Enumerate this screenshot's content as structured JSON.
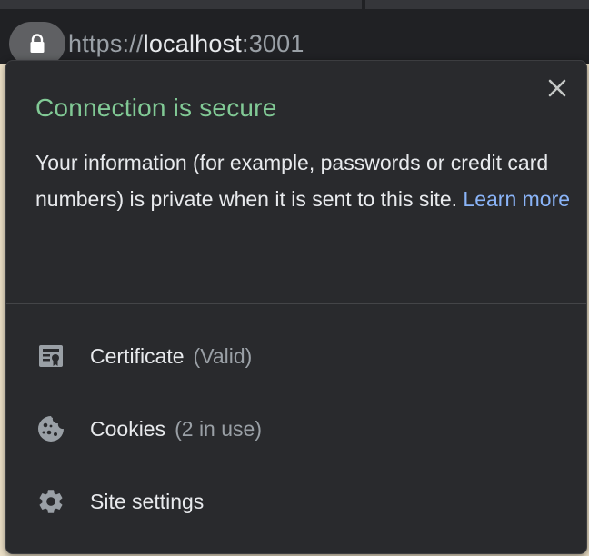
{
  "toolbar": {
    "url_scheme": "https://",
    "url_host": "localhost",
    "url_port": ":3001",
    "lock_icon": "lock-icon"
  },
  "popup": {
    "title": "Connection is secure",
    "description": "Your information (for example, passwords or credit card numbers) is private when it is sent to this site.",
    "learn_more": "Learn more",
    "close_icon": "close-icon",
    "items": [
      {
        "label": "Certificate",
        "sub": "(Valid)",
        "icon": "certificate-icon"
      },
      {
        "label": "Cookies",
        "sub": "(2 in use)",
        "icon": "cookie-icon"
      },
      {
        "label": "Site settings",
        "sub": "",
        "icon": "gear-icon"
      }
    ]
  },
  "colors": {
    "secure_green": "#81c995",
    "link_blue": "#8ab4f8",
    "popup_bg": "#292a2d",
    "text_primary": "#e8eaed",
    "text_secondary": "#9aa0a6"
  }
}
